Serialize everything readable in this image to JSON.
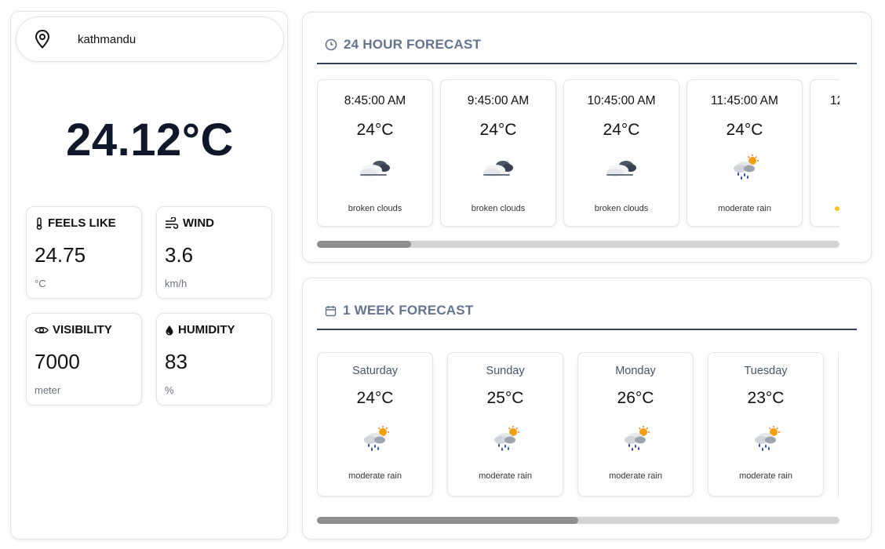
{
  "location": {
    "city": "kathmandu"
  },
  "current": {
    "temperature": "24.12°C"
  },
  "stats": [
    {
      "label": "FEELS LIKE",
      "value": "24.75",
      "unit": "°C",
      "icon": "thermometer-icon"
    },
    {
      "label": "WIND",
      "value": "3.6",
      "unit": "km/h",
      "icon": "wind-icon"
    },
    {
      "label": "VISIBILITY",
      "value": "7000",
      "unit": "meter",
      "icon": "eye-icon"
    },
    {
      "label": "HUMIDITY",
      "value": "83",
      "unit": "%",
      "icon": "droplet-icon"
    }
  ],
  "hourly": {
    "title": "24 HOUR FORECAST",
    "items": [
      {
        "time": "8:45:00 AM",
        "temp": "24°C",
        "desc": "broken clouds",
        "icon": "broken-clouds-icon"
      },
      {
        "time": "9:45:00 AM",
        "temp": "24°C",
        "desc": "broken clouds",
        "icon": "broken-clouds-icon"
      },
      {
        "time": "10:45:00 AM",
        "temp": "24°C",
        "desc": "broken clouds",
        "icon": "broken-clouds-icon"
      },
      {
        "time": "11:45:00 AM",
        "temp": "24°C",
        "desc": "moderate rain",
        "icon": "moderate-rain-icon"
      },
      {
        "time": "12",
        "temp": "",
        "desc": "",
        "icon": "sun-icon"
      }
    ],
    "scroll_fraction": 0.18
  },
  "weekly": {
    "title": "1 WEEK FORECAST",
    "items": [
      {
        "day": "Saturday",
        "temp": "24°C",
        "desc": "moderate rain",
        "icon": "moderate-rain-icon"
      },
      {
        "day": "Sunday",
        "temp": "25°C",
        "desc": "moderate rain",
        "icon": "moderate-rain-icon"
      },
      {
        "day": "Monday",
        "temp": "26°C",
        "desc": "moderate rain",
        "icon": "moderate-rain-icon"
      },
      {
        "day": "Tuesday",
        "temp": "23°C",
        "desc": "moderate rain",
        "icon": "moderate-rain-icon"
      }
    ],
    "scroll_fraction": 0.5
  }
}
